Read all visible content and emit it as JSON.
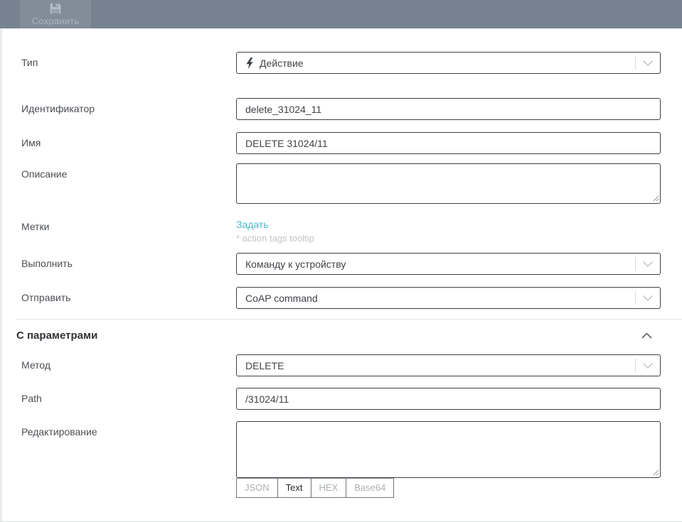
{
  "toolbar": {
    "save_label": "Сохранить"
  },
  "fields": {
    "type": {
      "label": "Тип",
      "value": "Действие"
    },
    "identifier": {
      "label": "Идентификатор",
      "value": "delete_31024_11"
    },
    "name": {
      "label": "Имя",
      "value": "DELETE 31024/11"
    },
    "description": {
      "label": "Описание",
      "value": ""
    },
    "tags": {
      "label": "Метки",
      "link_label": "Задать",
      "hint": "* action tags tooltip"
    },
    "execute": {
      "label": "Выполнить",
      "value": "Команду к устройству"
    },
    "send": {
      "label": "Отправить",
      "value": "CoAP command"
    }
  },
  "params_section": {
    "title": "С параметрами",
    "method": {
      "label": "Метод",
      "value": "DELETE"
    },
    "path": {
      "label": "Path",
      "value": "/31024/11"
    },
    "editor": {
      "label": "Редактирование",
      "value": "",
      "tabs": [
        {
          "label": "JSON"
        },
        {
          "label": "Text"
        },
        {
          "label": "HEX"
        },
        {
          "label": "Base64"
        }
      ],
      "active_tab": "Text"
    }
  },
  "icons": {
    "save": "floppy-disk-icon",
    "type_value": "lightning-bolt-icon",
    "select": "chevron-down-icon",
    "section_collapse": "chevron-up-icon",
    "textarea_corner": "resize-grip-icon"
  },
  "colors": {
    "toolbar_bg": "#76828F",
    "save_button_bg": "#818D99",
    "link_accent": "#4CB8C8",
    "input_border": "#3B4045"
  }
}
